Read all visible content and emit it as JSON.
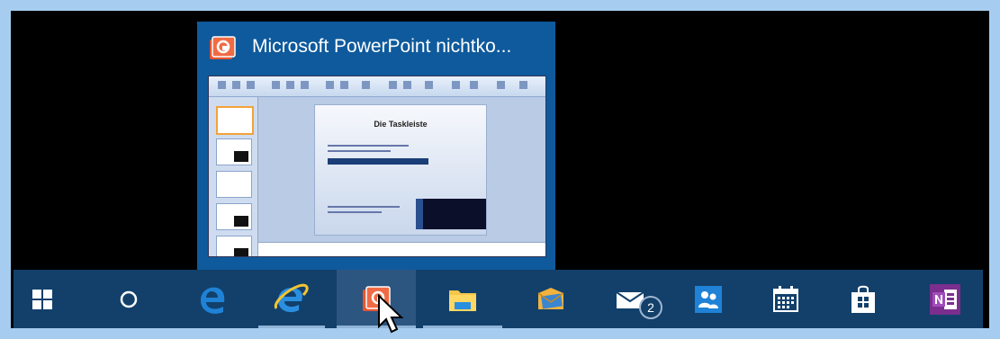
{
  "preview": {
    "title": "Microsoft PowerPoint nichtko...",
    "app_icon": "powerpoint-icon",
    "thumbnail": {
      "slide_title": "Die Taskleiste"
    }
  },
  "taskbar": {
    "items": [
      {
        "name": "start",
        "icon": "windows-logo-icon"
      },
      {
        "name": "search",
        "icon": "cortana-circle-icon"
      },
      {
        "name": "edge",
        "icon": "edge-icon"
      },
      {
        "name": "internet-explorer",
        "icon": "internet-explorer-icon"
      },
      {
        "name": "powerpoint",
        "icon": "powerpoint-icon",
        "hovered": true
      },
      {
        "name": "file-explorer",
        "icon": "folder-icon"
      },
      {
        "name": "outlook",
        "icon": "outlook-icon"
      },
      {
        "name": "mail",
        "icon": "mail-icon",
        "badge": "2"
      },
      {
        "name": "people",
        "icon": "people-icon"
      },
      {
        "name": "calendar",
        "icon": "calendar-icon"
      },
      {
        "name": "store",
        "icon": "store-icon"
      },
      {
        "name": "onenote",
        "icon": "onenote-icon"
      }
    ]
  },
  "colors": {
    "taskbar": "#12406b",
    "preview_bg": "#0e5a9c",
    "border": "#a6cdef",
    "powerpoint": "#e8542f",
    "accent": "#1f82d6"
  }
}
